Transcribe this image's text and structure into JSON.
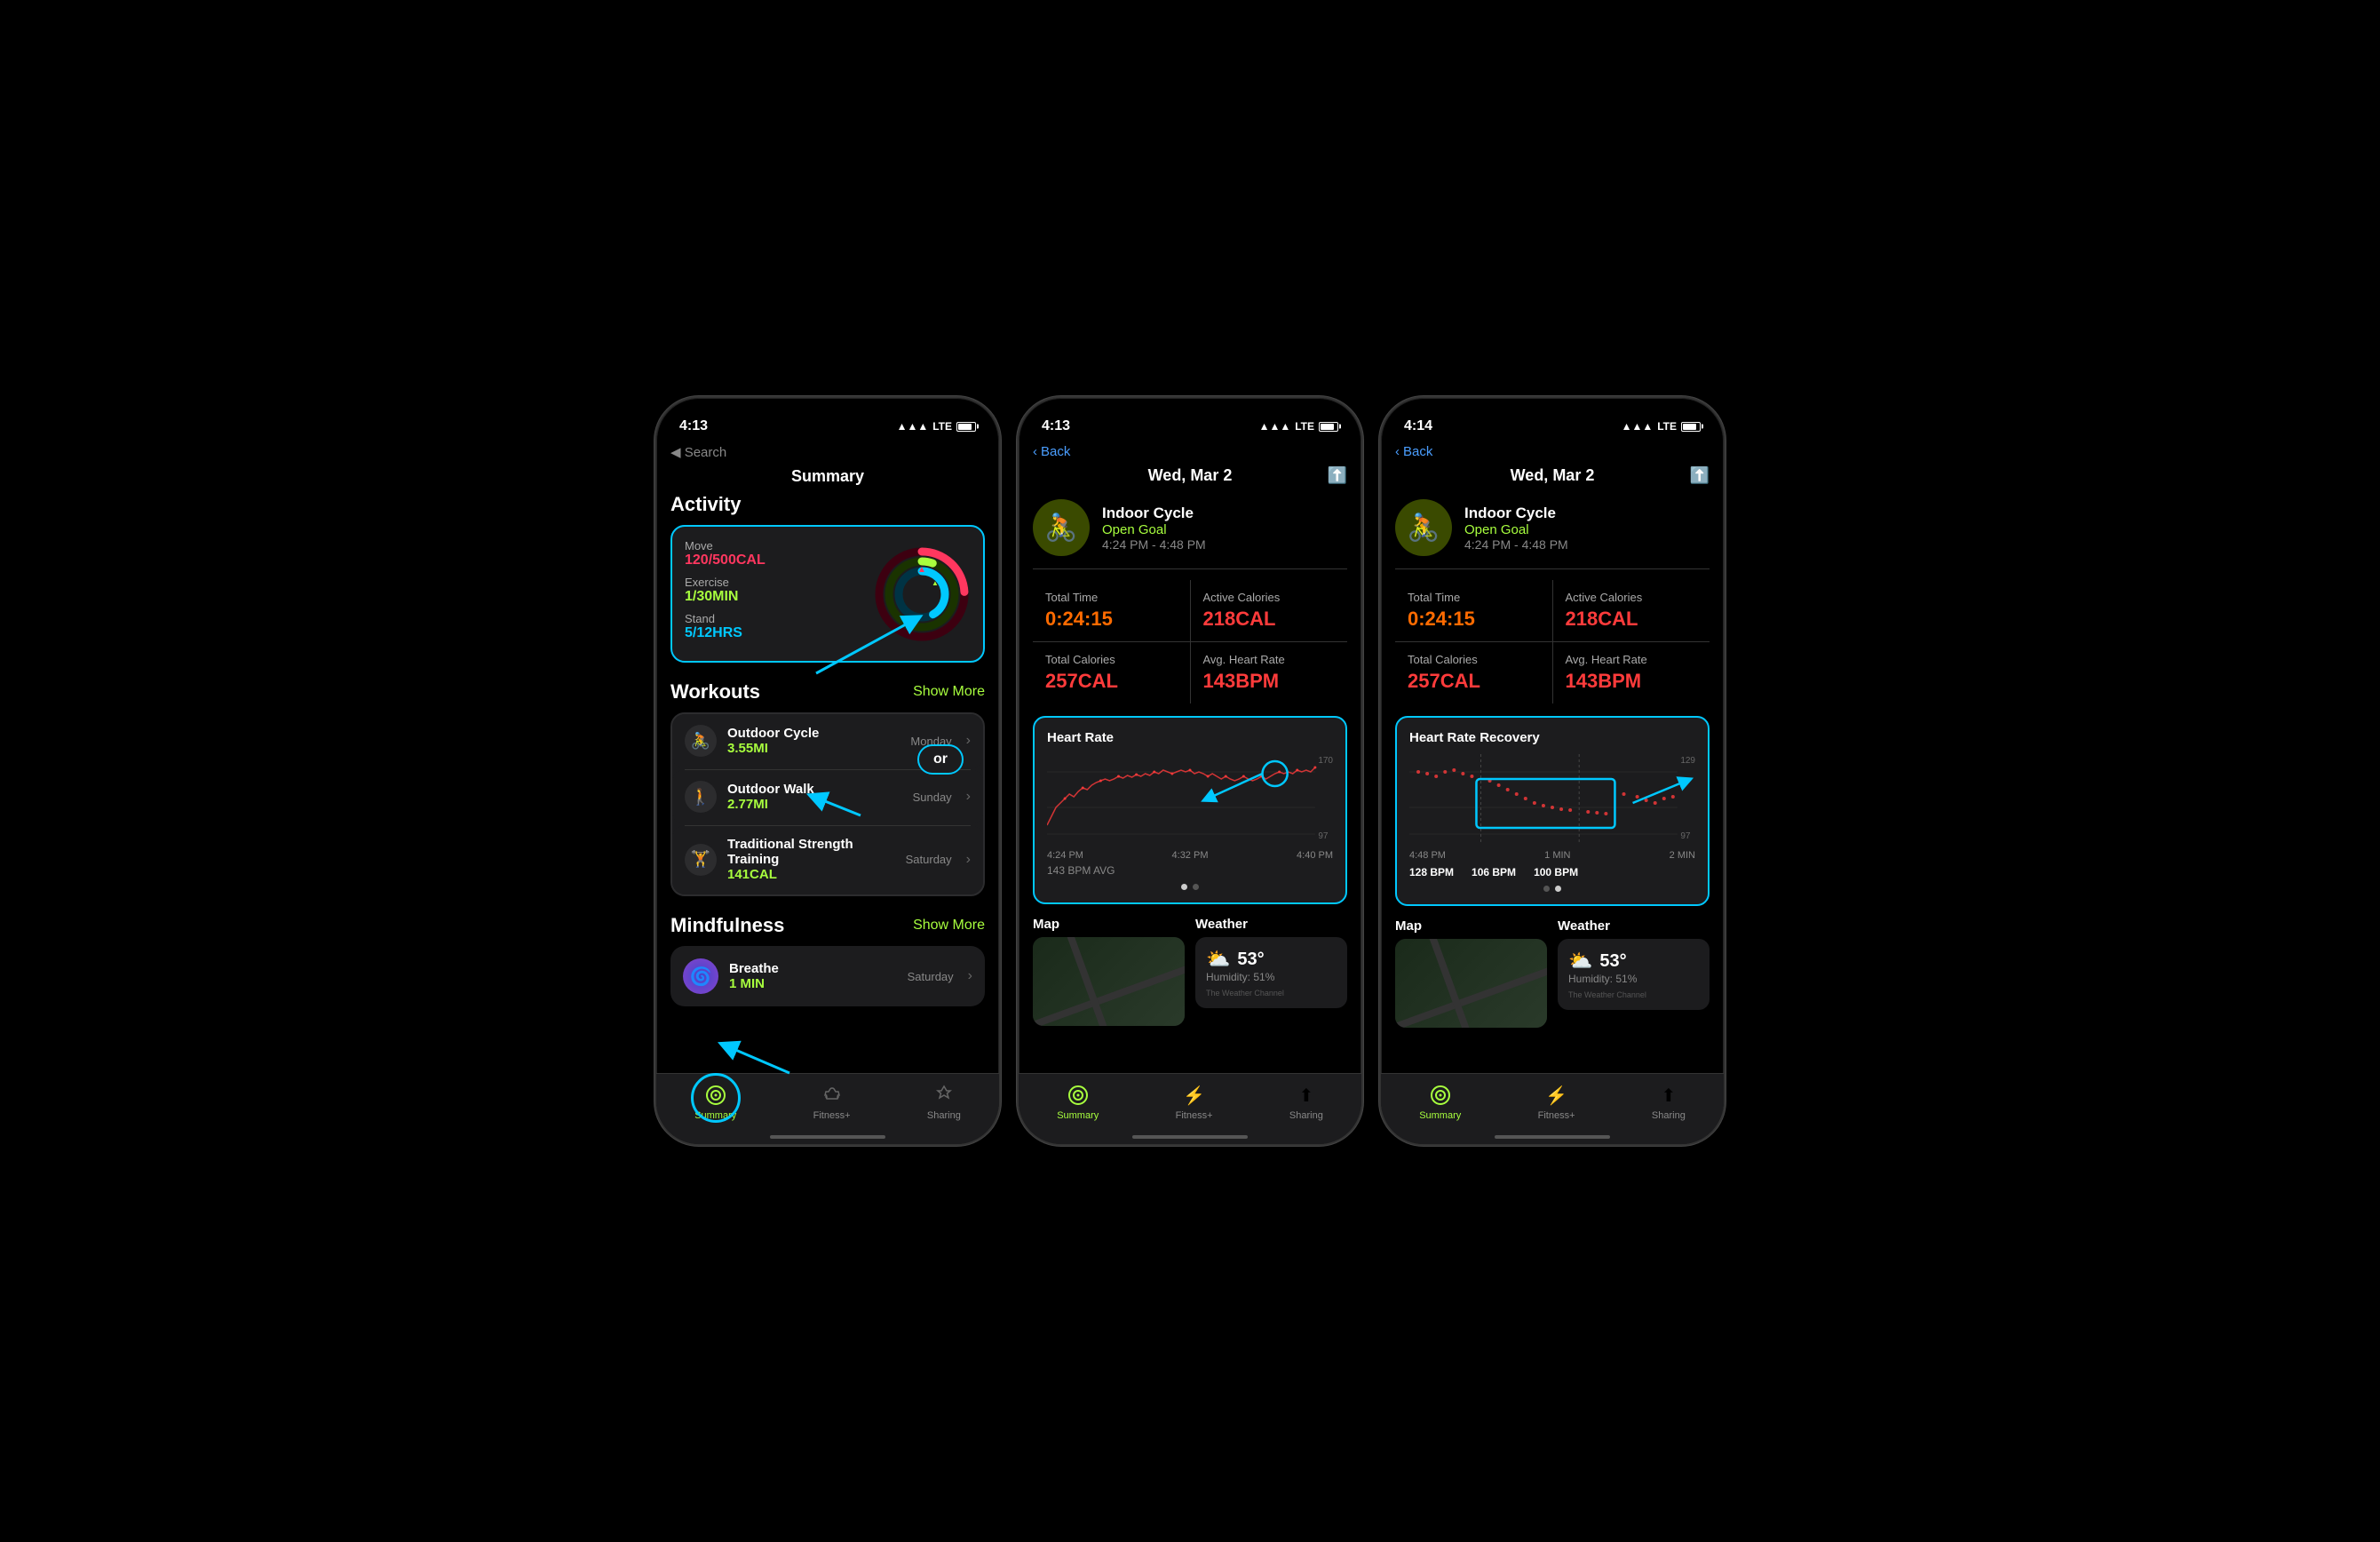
{
  "screen1": {
    "status_time": "4:13",
    "status_signal": "●●●",
    "status_lte": "LTE",
    "back_search": "◀ Search",
    "title": "Summary",
    "activity_title": "Activity",
    "move_label": "Move",
    "move_value": "120/500CAL",
    "exercise_label": "Exercise",
    "exercise_value": "1/30MIN",
    "stand_label": "Stand",
    "stand_value": "5/12HRS",
    "workouts_title": "Workouts",
    "show_more": "Show More",
    "workout1_name": "Outdoor Cycle",
    "workout1_value": "3.55MI",
    "workout1_day": "Monday",
    "workout2_name": "Outdoor Walk",
    "workout2_value": "2.77MI",
    "workout2_day": "Sunday",
    "workout3_name": "Traditional Strength Training",
    "workout3_value": "141CAL",
    "workout3_day": "Saturday",
    "mindfulness_title": "Mindfulness",
    "mindfulness_show_more": "Show More",
    "breathe_name": "Breathe",
    "breathe_value": "1 MIN",
    "breathe_day": "Saturday",
    "tab_summary": "Summary",
    "tab_fitness": "Fitness+",
    "tab_sharing": "Sharing",
    "or_label": "or"
  },
  "screen2": {
    "status_time": "4:13",
    "back_label": "Back",
    "header_title": "Wed, Mar 2",
    "workout_type": "Indoor Cycle",
    "workout_goal": "Open Goal",
    "workout_time_range": "4:24 PM - 4:48 PM",
    "total_time_label": "Total Time",
    "total_time_value": "0:24:15",
    "active_cal_label": "Active Calories",
    "active_cal_value": "218CAL",
    "total_cal_label": "Total Calories",
    "total_cal_value": "257CAL",
    "avg_hr_label": "Avg. Heart Rate",
    "avg_hr_value": "143BPM",
    "chart_title": "Heart Rate",
    "chart_scale_high": "170",
    "chart_scale_low": "97",
    "time1": "4:24 PM",
    "time2": "4:32 PM",
    "time3": "4:40 PM",
    "bpm_avg": "143 BPM AVG",
    "map_label": "Map",
    "weather_label": "Weather",
    "weather_temp": "53°",
    "weather_humidity": "Humidity: 51%",
    "tab_summary": "Summary",
    "tab_fitness": "Fitness+",
    "tab_sharing": "Sharing"
  },
  "screen3": {
    "status_time": "4:14",
    "back_label": "Back",
    "header_title": "Wed, Mar 2",
    "workout_type": "Indoor Cycle",
    "workout_goal": "Open Goal",
    "workout_time_range": "4:24 PM - 4:48 PM",
    "total_time_label": "Total Time",
    "total_time_value": "0:24:15",
    "active_cal_label": "Active Calories",
    "active_cal_value": "218CAL",
    "total_cal_label": "Total Calories",
    "total_cal_value": "257CAL",
    "avg_hr_label": "Avg. Heart Rate",
    "avg_hr_value": "143BPM",
    "chart_title": "Heart Rate Recovery",
    "chart_scale_high": "129",
    "chart_scale_low": "97",
    "time1": "4:48 PM",
    "time2": "1 MIN",
    "time3": "2 MIN",
    "bpm1": "128 BPM",
    "bpm2": "106 BPM",
    "bpm3": "100 BPM",
    "map_label": "Map",
    "weather_label": "Weather",
    "weather_temp": "53°",
    "weather_humidity": "Humidity: 51%",
    "tab_summary": "Summary",
    "tab_fitness": "Fitness+",
    "tab_sharing": "Sharing"
  }
}
